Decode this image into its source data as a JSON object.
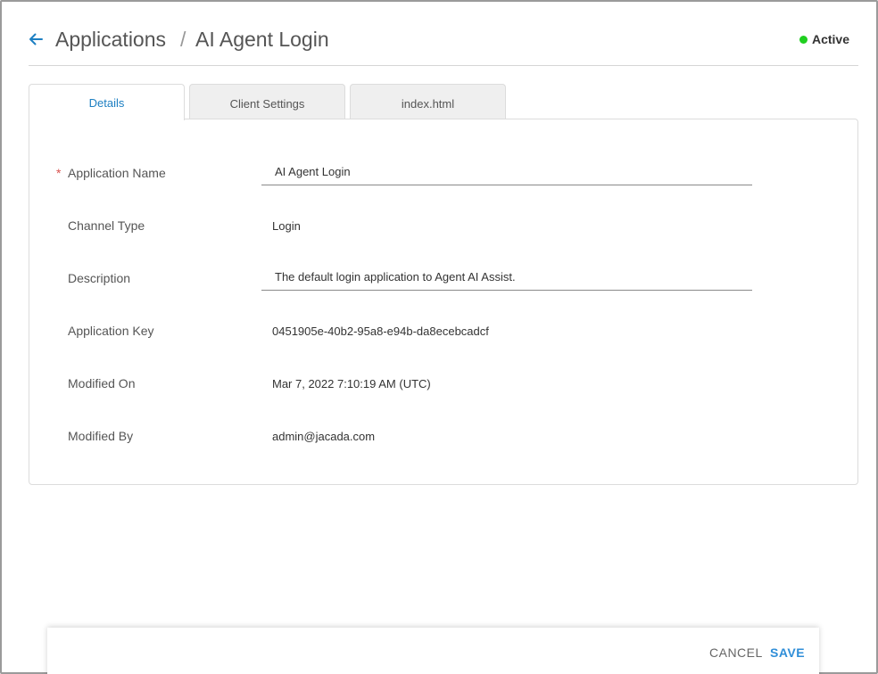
{
  "breadcrumb": {
    "parent": "Applications",
    "separator": "/",
    "current": "AI Agent Login"
  },
  "status": {
    "label": "Active",
    "color": "#1fcf1f"
  },
  "tabs": [
    {
      "label": "Details",
      "active": true
    },
    {
      "label": "Client Settings",
      "active": false
    },
    {
      "label": "index.html",
      "active": false
    }
  ],
  "fields": {
    "application_name": {
      "label": "Application Name",
      "required_mark": "*",
      "value": "AI Agent Login"
    },
    "channel_type": {
      "label": "Channel Type",
      "value": "Login"
    },
    "description": {
      "label": "Description",
      "value": "The default login application to Agent AI Assist."
    },
    "application_key": {
      "label": "Application Key",
      "value": "0451905e-40b2-95a8-e94b-da8ecebcadcf"
    },
    "modified_on": {
      "label": "Modified On",
      "value": "Mar 7, 2022 7:10:19 AM (UTC)"
    },
    "modified_by": {
      "label": "Modified By",
      "value": "admin@jacada.com"
    }
  },
  "footer": {
    "cancel_label": "CANCEL",
    "save_label": "SAVE"
  },
  "icons": {
    "back": "arrow-left-icon"
  },
  "colors": {
    "accent": "#1d7fc2",
    "save": "#2f8ed8",
    "required": "#d9534f"
  }
}
